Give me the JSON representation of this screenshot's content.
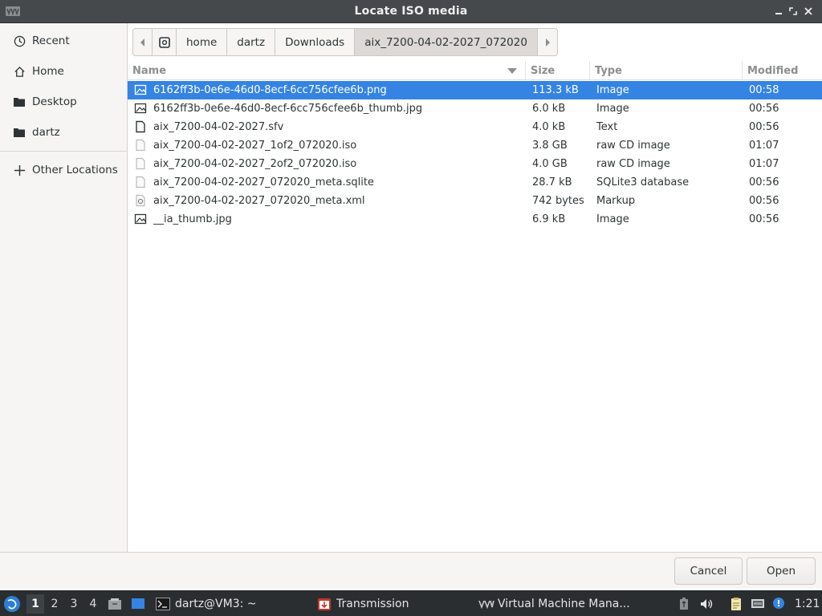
{
  "window": {
    "title": "Locate ISO media"
  },
  "sidebar": {
    "items": [
      {
        "label": "Recent",
        "icon": "clock-icon"
      },
      {
        "label": "Home",
        "icon": "home-icon"
      },
      {
        "label": "Desktop",
        "icon": "folder-icon"
      },
      {
        "label": "dartz",
        "icon": "folder-icon"
      },
      {
        "label": "Other Locations",
        "icon": "plus-icon"
      }
    ]
  },
  "pathbar": {
    "segments": [
      "home",
      "dartz",
      "Downloads",
      "aix_7200-04-02-2027_072020"
    ]
  },
  "columns": {
    "name": "Name",
    "size": "Size",
    "type": "Type",
    "modified": "Modified"
  },
  "files": [
    {
      "name": "6162ff3b-0e6e-46d0-8ecf-6cc756cfee6b.png",
      "size": "113.3 kB",
      "type": "Image",
      "modified": "00:58",
      "icon": "image-icon",
      "selected": true
    },
    {
      "name": "6162ff3b-0e6e-46d0-8ecf-6cc756cfee6b_thumb.jpg",
      "size": "6.0 kB",
      "type": "Image",
      "modified": "00:56",
      "icon": "image-icon"
    },
    {
      "name": "aix_7200-04-02-2027.sfv",
      "size": "4.0 kB",
      "type": "Text",
      "modified": "00:56",
      "icon": "text-file-icon"
    },
    {
      "name": "aix_7200-04-02-2027_1of2_072020.iso",
      "size": "3.8 GB",
      "type": "raw CD image",
      "modified": "01:07",
      "icon": "generic-file-icon"
    },
    {
      "name": "aix_7200-04-02-2027_2of2_072020.iso",
      "size": "4.0 GB",
      "type": "raw CD image",
      "modified": "01:07",
      "icon": "generic-file-icon"
    },
    {
      "name": "aix_7200-04-02-2027_072020_meta.sqlite",
      "size": "28.7 kB",
      "type": "SQLite3 database",
      "modified": "00:56",
      "icon": "generic-file-icon"
    },
    {
      "name": "aix_7200-04-02-2027_072020_meta.xml",
      "size": "742 bytes",
      "type": "Markup",
      "modified": "00:56",
      "icon": "markup-file-icon"
    },
    {
      "name": "__ia_thumb.jpg",
      "size": "6.9 kB",
      "type": "Image",
      "modified": "00:56",
      "icon": "image-icon"
    }
  ],
  "buttons": {
    "cancel": "Cancel",
    "open": "Open"
  },
  "taskbar": {
    "workspaces": [
      "1",
      "2",
      "3",
      "4"
    ],
    "active_workspace": "1",
    "tasks": [
      {
        "label": "dartz@VM3: ~",
        "icon": "terminal-icon"
      },
      {
        "label": "Transmission",
        "icon": "transmission-icon"
      },
      {
        "label": "Virtual Machine Mana...",
        "icon": "virt-manager-icon"
      }
    ],
    "clock": "1:21"
  },
  "colors": {
    "selection": "#3584e4",
    "titlebar": "#45494c",
    "taskbar": "#2b2e31"
  }
}
